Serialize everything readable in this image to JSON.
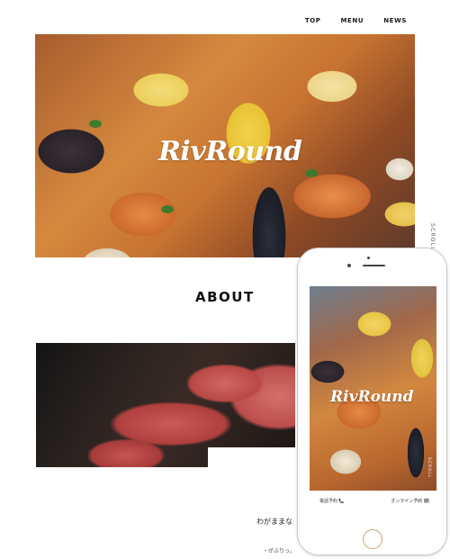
{
  "nav": {
    "items": [
      "TOP",
      "MENU",
      "NEWS"
    ]
  },
  "hero": {
    "title": "RivRound",
    "scroll_label": "SCROLL"
  },
  "about": {
    "heading": "ABOUT",
    "text": "わがままな",
    "sub": "・がぶりっ。"
  },
  "phone": {
    "screen_title": "RivRound",
    "scroll_label": "SCROLL",
    "bar_left": "電話予約 📞",
    "bar_right": "オンライン予約 🗓"
  },
  "colors": {
    "accent": "#c9a36a",
    "text": "#222222",
    "background": "#ffffff"
  }
}
